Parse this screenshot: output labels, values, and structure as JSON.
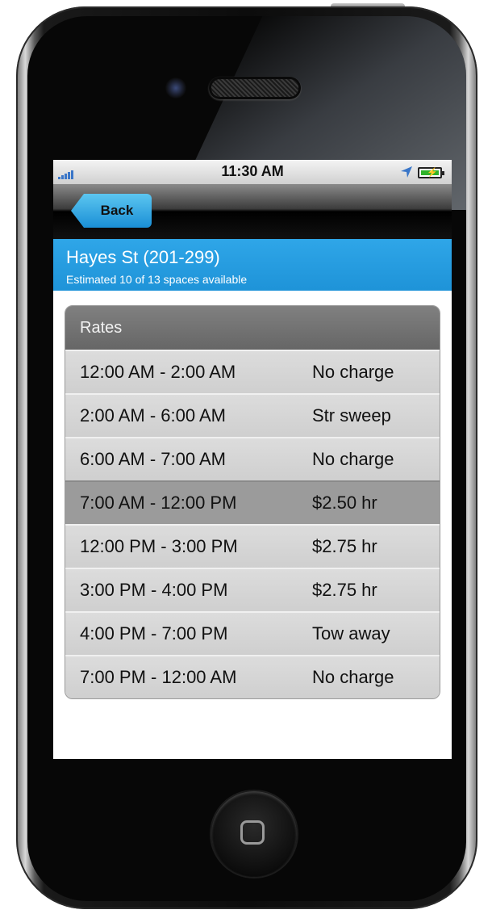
{
  "status_bar": {
    "time": "11:30 AM"
  },
  "nav": {
    "back_label": "Back"
  },
  "location": {
    "title": "Hayes St (201-299)",
    "availability": "Estimated 10 of 13 spaces available"
  },
  "rates": {
    "header": "Rates",
    "rows": [
      {
        "time": "12:00 AM - 2:00 AM",
        "price": "No charge"
      },
      {
        "time": "2:00 AM - 6:00 AM",
        "price": "Str sweep"
      },
      {
        "time": "6:00 AM - 7:00 AM",
        "price": "No charge"
      },
      {
        "time": "7:00 AM - 12:00 PM",
        "price": "$2.50 hr"
      },
      {
        "time": "12:00 PM - 3:00 PM",
        "price": "$2.75 hr"
      },
      {
        "time": "3:00 PM - 4:00 PM",
        "price": "$2.75 hr"
      },
      {
        "time": "4:00 PM - 7:00 PM",
        "price": "Tow away"
      },
      {
        "time": "7:00 PM - 12:00 AM",
        "price": "No charge"
      }
    ],
    "selected_index": 3
  },
  "colors": {
    "header_blue": "#2fa6e8",
    "back_button": "#1a8fd6",
    "selected_row": "#9b9b9b",
    "battery": "#2fb32a"
  },
  "icons": [
    "signal-icon",
    "location-arrow-icon",
    "battery-icon",
    "home-button-icon"
  ]
}
